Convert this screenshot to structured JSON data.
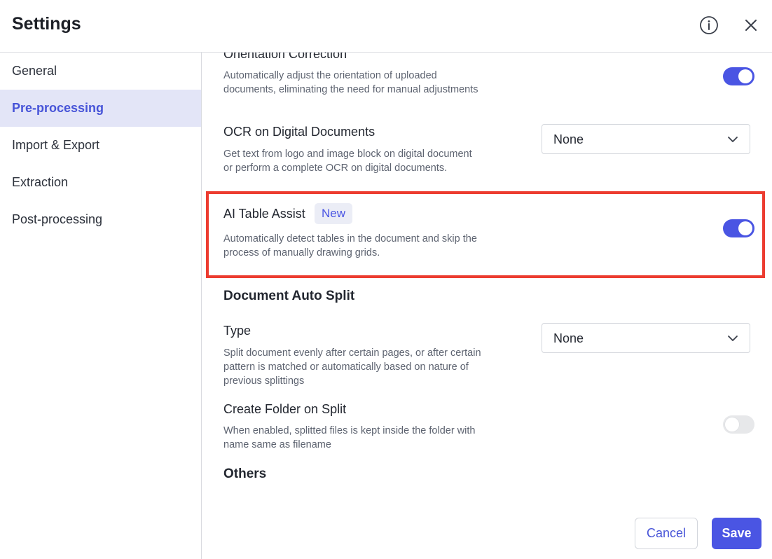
{
  "header": {
    "title": "Settings",
    "info_icon": "info-icon",
    "close_icon": "close-icon"
  },
  "sidebar": {
    "items": [
      {
        "label": "General",
        "active": false
      },
      {
        "label": "Pre-processing",
        "active": true
      },
      {
        "label": "Import & Export",
        "active": false
      },
      {
        "label": "Extraction",
        "active": false
      },
      {
        "label": "Post-processing",
        "active": false
      }
    ]
  },
  "settings": {
    "orientation": {
      "title": "Orientation Correction",
      "description": "Automatically adjust the orientation of uploaded documents, eliminating the need for manual adjustments",
      "enabled": true
    },
    "ocr_digital": {
      "title": "OCR on Digital Documents",
      "description": "Get text from logo and image block on digital document or perform a complete OCR on digital documents.",
      "selected": "None"
    },
    "ai_table": {
      "title": "AI Table Assist",
      "badge": "New",
      "description": "Automatically detect tables in the document and skip the process of manually drawing grids.",
      "enabled": true
    }
  },
  "auto_split": {
    "section_title": "Document Auto Split",
    "type": {
      "title": "Type",
      "description": "Split document evenly after certain pages, or after certain pattern is matched or automatically based on nature of previous splittings",
      "selected": "None"
    },
    "create_folder": {
      "title": "Create Folder on Split",
      "description": "When enabled, splitted files is kept inside the folder with name same as filename",
      "enabled": false
    }
  },
  "others": {
    "section_title": "Others"
  },
  "footer": {
    "cancel_label": "Cancel",
    "save_label": "Save"
  },
  "colors": {
    "accent": "#4a55e3",
    "highlight_border": "#ec3c30",
    "active_nav_bg": "#e3e5f7"
  }
}
